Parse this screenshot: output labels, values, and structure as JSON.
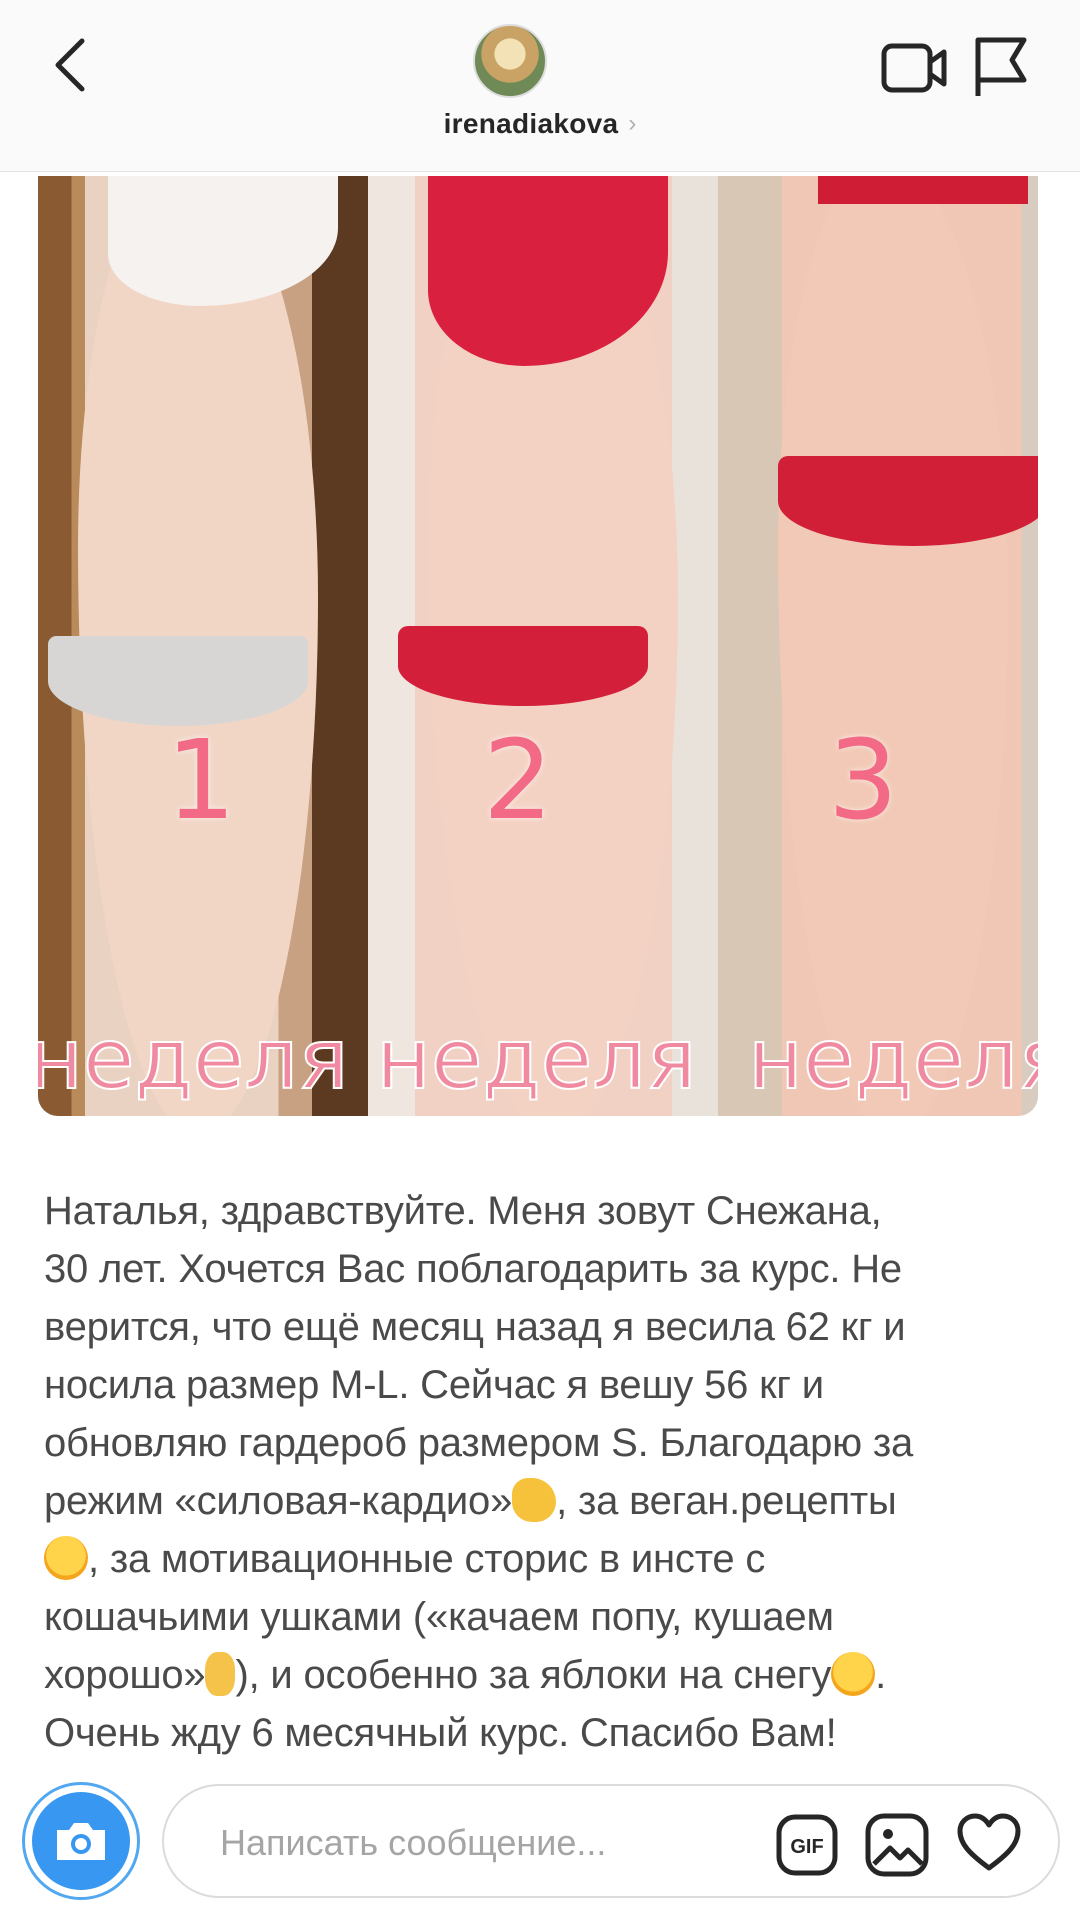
{
  "header": {
    "username": "irenadiakova",
    "username_chevron": "›",
    "icons": {
      "back": "chevron-left-icon",
      "video": "video-camera-icon",
      "flag": "flag-icon"
    }
  },
  "post_image": {
    "panels": [
      {
        "number": "1",
        "label": "неделя"
      },
      {
        "number": "2",
        "label": "неделя"
      },
      {
        "number": "3",
        "label": "неделя"
      }
    ]
  },
  "caption": {
    "lines": [
      "Наталья, здравствуйте. Меня зовут Снежана,",
      "30 лет. Хочется Вас поблагодарить за курс. Не",
      "верится, что ещё месяц назад я весила 62 кг и",
      "носила размер M-L. Сейчас я вешу 56 кг и",
      "обновляю гардероб размером S. Благодарю за",
      "режим «силовая-кардио»",
      ", за веган.рецепты",
      ", за мотивационные сторис в инсте с",
      "кошачьими ушками («качаем попу, кушаем",
      "хорошо»",
      "), и особенно за яблоки на снегу",
      ".",
      "Очень жду 6 месячный курс. Спасибо Вам",
      "!"
    ],
    "emojis": [
      "flexed-biceps",
      "slightly-frowning-face",
      "index-pointing-up",
      "grinning-face"
    ]
  },
  "composer": {
    "placeholder": "Написать сообщение...",
    "gif_label": "GIF",
    "icons": {
      "camera": "camera-icon",
      "gif": "gif-icon",
      "gallery": "gallery-icon",
      "heart": "heart-icon"
    },
    "accent_color": "#3897f0"
  }
}
